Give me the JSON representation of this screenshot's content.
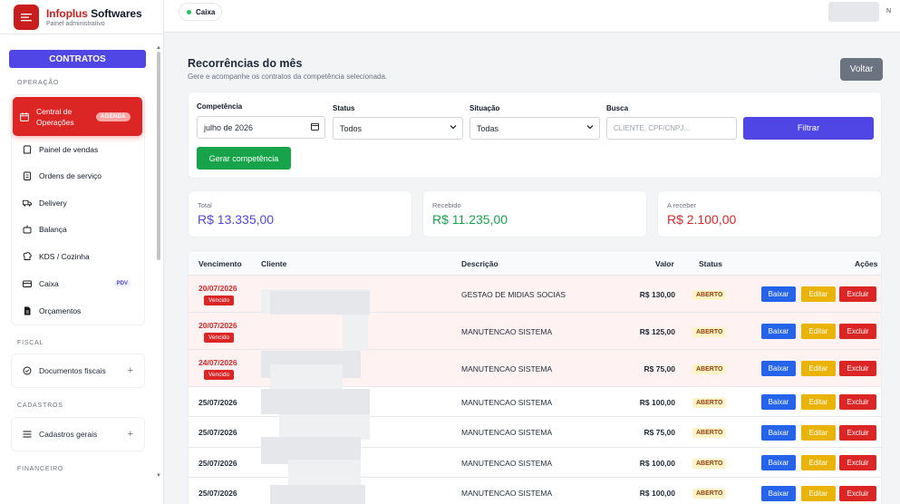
{
  "brand": {
    "title_red": "Infoplus",
    "title_dark": " Softwares",
    "subtitle": "Painel administrativo"
  },
  "sidebar": {
    "contracts_button": "CONTRATOS",
    "sections": {
      "operacao": "OPERAÇÃO",
      "fiscal": "FISCAL",
      "cadastros": "CADASTROS",
      "financeiro": "FINANCEIRO"
    },
    "active_item": {
      "label": "Central de Operações",
      "badge": "AGENDA"
    },
    "items": [
      {
        "label": "Painel de vendas",
        "icon": "store-icon"
      },
      {
        "label": "Ordens de serviço",
        "icon": "clipboard-icon"
      },
      {
        "label": "Delivery",
        "icon": "truck-icon"
      },
      {
        "label": "Balança",
        "icon": "scale-icon"
      },
      {
        "label": "KDS / Cozinha",
        "icon": "chef-icon"
      },
      {
        "label": "Caixa",
        "icon": "cash-register-icon",
        "badge": "PDV"
      },
      {
        "label": "Orçamentos",
        "icon": "document-icon"
      }
    ],
    "fiscal_item": "Documentos fiscais",
    "cadastros_item": "Cadastros gerais"
  },
  "topbar": {
    "caixa_label": "Caixa",
    "user_initial": "N"
  },
  "page": {
    "title": "Recorrências do mês",
    "subtitle": "Gere e acompanhe os contratos da competência selecionada.",
    "back_button": "Voltar"
  },
  "filters": {
    "competencia_label": "Competência",
    "competencia_value": "julho de 2026",
    "status_label": "Status",
    "status_value": "Todos",
    "situacao_label": "Situação",
    "situacao_value": "Todas",
    "busca_label": "Busca",
    "busca_placeholder": "CLIENTE, CPF/CNPJ...",
    "filter_button": "Filtrar",
    "generate_button": "Gerar competência"
  },
  "stats": {
    "total_label": "Total",
    "total_value": "R$ 13.335,00",
    "recebido_label": "Recebido",
    "recebido_value": "R$ 11.235,00",
    "areceber_label": "A receber",
    "areceber_value": "R$ 2.100,00"
  },
  "colors": {
    "accent": "#4f46e5",
    "brand_red": "#c81e1e",
    "success": "#16a34a",
    "danger": "#dc2626",
    "warning": "#eab308"
  },
  "table": {
    "headers": {
      "vencimento": "Vencimento",
      "cliente": "Cliente",
      "descricao": "Descrição",
      "valor": "Valor",
      "status": "Status",
      "acoes": "Ações"
    },
    "action_labels": {
      "baixar": "Baixar",
      "editar": "Editar",
      "excluir": "Excluir"
    },
    "overdue_label": "Vencido",
    "rows": [
      {
        "date": "20/07/2026",
        "overdue": true,
        "descricao": "GESTAO DE MIDIAS SOCIAS",
        "valor": "R$ 130,00",
        "status": "ABERTO"
      },
      {
        "date": "20/07/2026",
        "overdue": true,
        "descricao": "MANUTENCAO SISTEMA",
        "valor": "R$ 125,00",
        "status": "ABERTO"
      },
      {
        "date": "24/07/2026",
        "overdue": true,
        "descricao": "MANUTENCAO SISTEMA",
        "valor": "R$ 75,00",
        "status": "ABERTO"
      },
      {
        "date": "25/07/2026",
        "overdue": false,
        "descricao": "MANUTENCAO SISTEMA",
        "valor": "R$ 100,00",
        "status": "ABERTO"
      },
      {
        "date": "25/07/2026",
        "overdue": false,
        "descricao": "MANUTENCAO SISTEMA",
        "valor": "R$ 75,00",
        "status": "ABERTO"
      },
      {
        "date": "25/07/2026",
        "overdue": false,
        "descricao": "MANUTENCAO SISTEMA",
        "valor": "R$ 100,00",
        "status": "ABERTO"
      },
      {
        "date": "25/07/2026",
        "overdue": false,
        "descricao": "MANUTENCAO SISTEMA",
        "valor": "R$ 100,00",
        "status": "ABERTO"
      }
    ]
  }
}
